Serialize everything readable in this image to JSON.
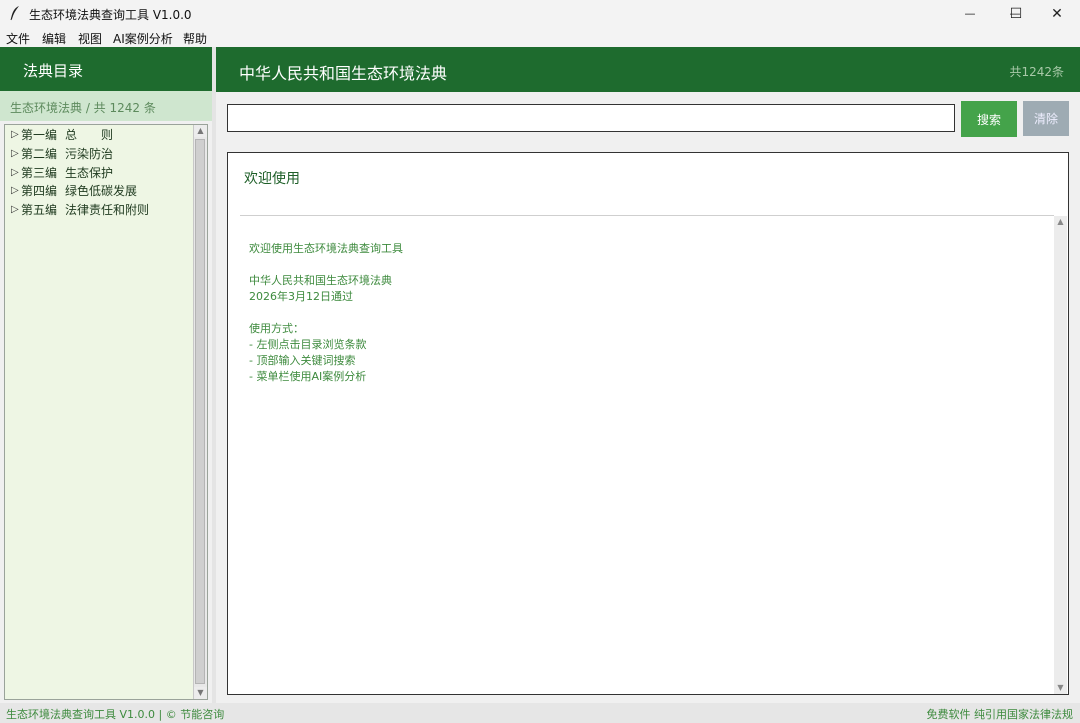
{
  "window": {
    "title": "生态环境法典查询工具 V1.0.0",
    "minimize_glyph": "—",
    "maximize_glyph": "☐",
    "close_glyph": "✕"
  },
  "menu": {
    "items": [
      "文件",
      "编辑",
      "视图",
      "AI案例分析",
      "帮助"
    ]
  },
  "sidebar": {
    "header": "法典目录",
    "subheader": "生态环境法典 / 共 1242 条",
    "tree": [
      {
        "part": "第一编",
        "name": "总　　则"
      },
      {
        "part": "第二编",
        "name": "污染防治"
      },
      {
        "part": "第三编",
        "name": "生态保护"
      },
      {
        "part": "第四编",
        "name": "绿色低碳发展"
      },
      {
        "part": "第五编",
        "name": "法律责任和附则"
      }
    ]
  },
  "main": {
    "title": "中华人民共和国生态环境法典",
    "count": "共1242条",
    "search": {
      "value": "",
      "placeholder": ""
    },
    "search_button": "搜索",
    "clear_button": "清除",
    "content_title": "欢迎使用",
    "content_lines": [
      "欢迎使用生态环境法典查询工具",
      "",
      "中华人民共和国生态环境法典",
      "2026年3月12日通过",
      "",
      "使用方式：",
      "- 左侧点击目录浏览条款",
      "- 顶部输入关键词搜索",
      "- 菜单栏使用AI案例分析"
    ]
  },
  "status": {
    "left": "生态环境法典查询工具 V1.0.0 | © 节能咨询",
    "right": "免费软件 纯引用国家法律法规"
  },
  "colors": {
    "header_green": "#1e6b2e",
    "search_button": "#44a34a",
    "clear_button": "#9eabb3",
    "text_green": "#3d8a3d"
  }
}
